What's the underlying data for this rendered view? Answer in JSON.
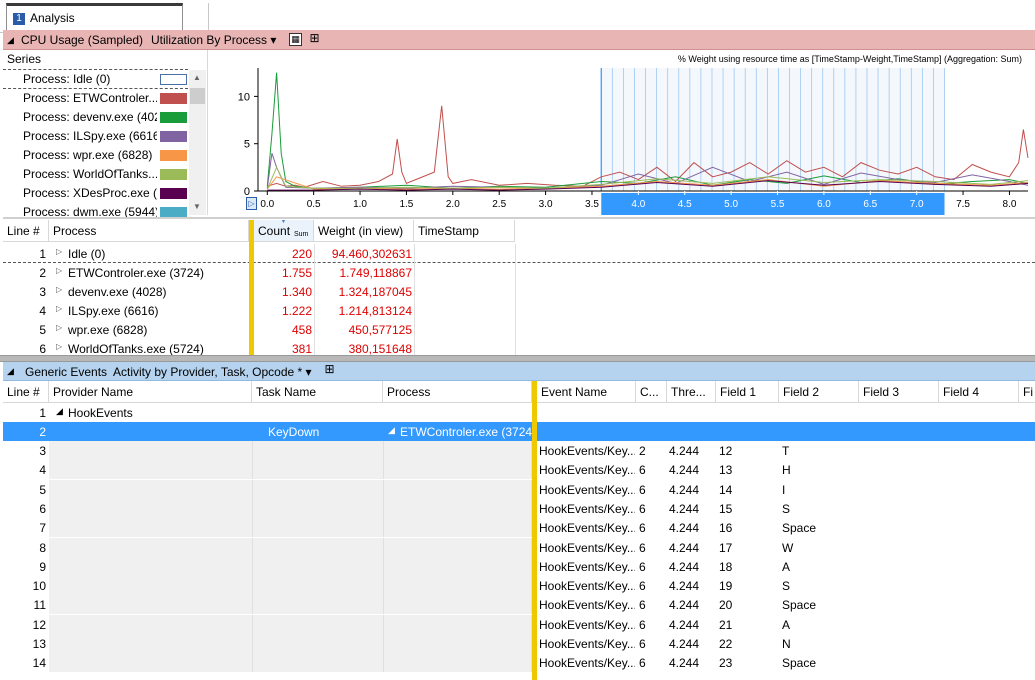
{
  "tab": {
    "number": "1",
    "label": "Analysis"
  },
  "cpu_header": {
    "title": "CPU Usage (Sampled)",
    "preset": "Utilization By Process ▾"
  },
  "series": {
    "header": "Series",
    "items": [
      {
        "label": "Process: Idle (0)",
        "color": "#ffffff"
      },
      {
        "label": "Process: ETWControler....",
        "color": "#c0504d"
      },
      {
        "label": "Process: devenv.exe (402...",
        "color": "#1a9c3a"
      },
      {
        "label": "Process: ILSpy.exe (6616)",
        "color": "#8064a2"
      },
      {
        "label": "Process: wpr.exe (6828)",
        "color": "#f79646"
      },
      {
        "label": "Process: WorldOfTanks....",
        "color": "#9bbb59"
      },
      {
        "label": "Process: XDesProc.exe (...",
        "color": "#5a0050"
      },
      {
        "label": "Process: dwm.exe (5944)",
        "color": "#4bacc6"
      }
    ]
  },
  "chart_data": {
    "type": "line",
    "title": "% Weight using resource time as [TimeStamp-Weight,TimeStamp] (Aggregation: Sum)",
    "xlabel": "",
    "ylabel": "",
    "xlim": [
      -0.1,
      8.2
    ],
    "ylim": [
      0,
      13
    ],
    "x_ticks": [
      "0.0",
      "0.5",
      "1.0",
      "1.5",
      "2.0",
      "2.5",
      "3.0",
      "3.5",
      "4.0",
      "4.5",
      "5.0",
      "5.5",
      "6.0",
      "6.5",
      "7.0",
      "7.5",
      "8.0"
    ],
    "y_ticks": [
      "0",
      "5",
      "10"
    ],
    "selection": [
      3.6,
      7.3
    ],
    "grid": false,
    "series": [
      {
        "name": "Process: ETWControler....",
        "color": "#c0504d",
        "x": [
          0.0,
          0.1,
          0.2,
          0.3,
          0.4,
          0.6,
          0.8,
          1.0,
          1.2,
          1.35,
          1.4,
          1.45,
          1.5,
          1.6,
          1.8,
          1.88,
          1.95,
          2.0,
          2.2,
          2.5,
          2.8,
          3.1,
          3.4,
          3.6,
          3.8,
          4.0,
          4.2,
          4.4,
          4.6,
          4.8,
          5.0,
          5.2,
          5.4,
          5.6,
          5.8,
          6.0,
          6.2,
          6.4,
          6.6,
          6.8,
          7.0,
          7.2,
          7.4,
          7.6,
          7.8,
          8.0,
          8.1,
          8.15,
          8.2
        ],
        "y": [
          0.5,
          0.8,
          0.5,
          0.6,
          0.4,
          1.0,
          0.5,
          0.6,
          1.0,
          1.8,
          5.5,
          2.0,
          0.8,
          1.2,
          2.0,
          9.0,
          1.5,
          0.8,
          1.2,
          0.6,
          0.8,
          0.6,
          0.5,
          1.5,
          2.0,
          1.2,
          2.5,
          1.0,
          3.0,
          1.5,
          2.0,
          3.0,
          1.8,
          3.2,
          2.0,
          2.5,
          1.5,
          3.0,
          2.2,
          1.8,
          2.5,
          1.5,
          1.2,
          2.8,
          2.0,
          1.5,
          3.0,
          6.5,
          3.5
        ]
      },
      {
        "name": "Process: devenv.exe (402...",
        "color": "#1a9c3a",
        "x": [
          0.0,
          0.05,
          0.1,
          0.15,
          0.2,
          0.3,
          0.5,
          1.0,
          1.5,
          2.0,
          2.5,
          3.0,
          3.6,
          4.0,
          4.4,
          4.8,
          5.2,
          5.6,
          6.0,
          6.4,
          6.8,
          7.2,
          7.6,
          8.0,
          8.2
        ],
        "y": [
          0.5,
          6.0,
          12.5,
          4.0,
          1.0,
          0.5,
          0.3,
          0.4,
          0.6,
          0.3,
          0.5,
          0.4,
          1.0,
          0.8,
          1.5,
          0.6,
          1.2,
          0.8,
          1.6,
          0.9,
          1.3,
          0.7,
          1.0,
          1.2,
          0.8
        ]
      },
      {
        "name": "Process: ILSpy.exe (6616)",
        "color": "#8064a2",
        "x": [
          0.0,
          0.05,
          0.1,
          0.2,
          0.5,
          1.0,
          1.5,
          2.0,
          2.5,
          3.0,
          3.6,
          4.0,
          4.4,
          4.8,
          5.2,
          5.6,
          6.0,
          6.4,
          6.8,
          7.2,
          7.6,
          8.0,
          8.2
        ],
        "y": [
          0.3,
          4.0,
          2.5,
          0.4,
          0.3,
          0.4,
          0.3,
          0.5,
          0.4,
          0.3,
          0.6,
          1.8,
          0.8,
          2.5,
          1.0,
          2.0,
          0.7,
          1.9,
          1.2,
          0.9,
          1.7,
          1.0,
          0.6
        ]
      },
      {
        "name": "Process: wpr.exe (6828)",
        "color": "#f79646",
        "x": [
          0.0,
          0.1,
          0.5,
          1.0,
          1.5,
          2.0,
          2.5,
          3.0,
          3.6,
          4.2,
          4.8,
          5.4,
          6.0,
          6.6,
          7.2,
          7.8,
          8.2
        ],
        "y": [
          0.2,
          1.5,
          0.2,
          0.3,
          0.2,
          0.3,
          0.2,
          0.3,
          0.5,
          1.0,
          0.6,
          1.2,
          0.5,
          1.1,
          0.8,
          0.6,
          0.9
        ]
      },
      {
        "name": "Process: WorldOfTanks....",
        "color": "#9bbb59",
        "x": [
          0.0,
          0.1,
          0.2,
          0.5,
          1.0,
          1.5,
          2.0,
          2.5,
          3.0,
          3.6,
          4.2,
          4.8,
          5.4,
          6.0,
          6.6,
          7.2,
          7.8,
          8.2
        ],
        "y": [
          0.2,
          2.5,
          0.5,
          0.3,
          0.3,
          0.4,
          0.3,
          0.4,
          0.3,
          0.7,
          1.3,
          0.8,
          1.5,
          0.9,
          1.2,
          1.0,
          0.7,
          1.1
        ]
      },
      {
        "name": "Process: XDesProc.exe (...",
        "color": "#5a0050",
        "x": [
          0.0,
          0.5,
          1.0,
          1.5,
          2.0,
          2.5,
          3.0,
          3.6,
          4.2,
          4.8,
          5.4,
          6.0,
          6.6,
          7.2,
          7.8,
          8.2
        ],
        "y": [
          0.1,
          0.1,
          0.2,
          0.1,
          0.2,
          0.1,
          0.2,
          0.4,
          0.9,
          0.5,
          1.1,
          0.6,
          1.0,
          0.7,
          0.5,
          0.8
        ]
      }
    ]
  },
  "grid1": {
    "headers": [
      "Line #",
      "Process",
      "Count",
      "Sum",
      "Weight (in view)",
      "TimeStamp"
    ],
    "rows": [
      {
        "line": "1",
        "process": "Idle (0)",
        "count": "220",
        "weight": "94.460,302631"
      },
      {
        "line": "2",
        "process": "ETWControler.exe (3724)",
        "count": "1.755",
        "weight": "1.749,118867"
      },
      {
        "line": "3",
        "process": "devenv.exe (4028)",
        "count": "1.340",
        "weight": "1.324,187045"
      },
      {
        "line": "4",
        "process": "ILSpy.exe (6616)",
        "count": "1.222",
        "weight": "1.214,813124"
      },
      {
        "line": "5",
        "process": "wpr.exe (6828)",
        "count": "458",
        "weight": "450,577125"
      },
      {
        "line": "6",
        "process": "WorldOfTanks.exe (5724)",
        "count": "381",
        "weight": "380,151648"
      }
    ]
  },
  "generic_header": {
    "title": "Generic Events",
    "preset": "Activity by Provider, Task, Opcode * ▾"
  },
  "grid2": {
    "headers": [
      "Line #",
      "Provider Name",
      "Task Name",
      "Process",
      "Event Name",
      "C...",
      "Thre...",
      "Field 1",
      "Field 2",
      "Field 3",
      "Field 4",
      "Fi"
    ],
    "group_row": {
      "line": "1",
      "provider": "HookEvents"
    },
    "selected_row": {
      "line": "2",
      "task": "KeyDown",
      "process": "ETWControler.exe (3724)"
    },
    "rows": [
      {
        "line": "3",
        "event": "HookEvents/Key...",
        "c": "2",
        "thread": "4.244",
        "f1": "12",
        "f2": "T"
      },
      {
        "line": "4",
        "event": "HookEvents/Key...",
        "c": "6",
        "thread": "4.244",
        "f1": "13",
        "f2": "H"
      },
      {
        "line": "5",
        "event": "HookEvents/Key...",
        "c": "6",
        "thread": "4.244",
        "f1": "14",
        "f2": "I"
      },
      {
        "line": "6",
        "event": "HookEvents/Key...",
        "c": "6",
        "thread": "4.244",
        "f1": "15",
        "f2": "S"
      },
      {
        "line": "7",
        "event": "HookEvents/Key...",
        "c": "6",
        "thread": "4.244",
        "f1": "16",
        "f2": "Space"
      },
      {
        "line": "8",
        "event": "HookEvents/Key...",
        "c": "6",
        "thread": "4.244",
        "f1": "17",
        "f2": "W"
      },
      {
        "line": "9",
        "event": "HookEvents/Key...",
        "c": "6",
        "thread": "4.244",
        "f1": "18",
        "f2": "A"
      },
      {
        "line": "10",
        "event": "HookEvents/Key...",
        "c": "6",
        "thread": "4.244",
        "f1": "19",
        "f2": "S"
      },
      {
        "line": "11",
        "event": "HookEvents/Key...",
        "c": "6",
        "thread": "4.244",
        "f1": "20",
        "f2": "Space"
      },
      {
        "line": "12",
        "event": "HookEvents/Key...",
        "c": "6",
        "thread": "4.244",
        "f1": "21",
        "f2": "A"
      },
      {
        "line": "13",
        "event": "HookEvents/Key...",
        "c": "6",
        "thread": "4.244",
        "f1": "22",
        "f2": "N"
      },
      {
        "line": "14",
        "event": "HookEvents/Key...",
        "c": "6",
        "thread": "4.244",
        "f1": "23",
        "f2": "Space"
      }
    ]
  },
  "colors": {
    "cpu_header": "#e8b4b4",
    "generic_header": "#b5d3ee",
    "selection": "#3399ff",
    "accent_yellow": "#f0c800",
    "value_red": "#e00000"
  }
}
